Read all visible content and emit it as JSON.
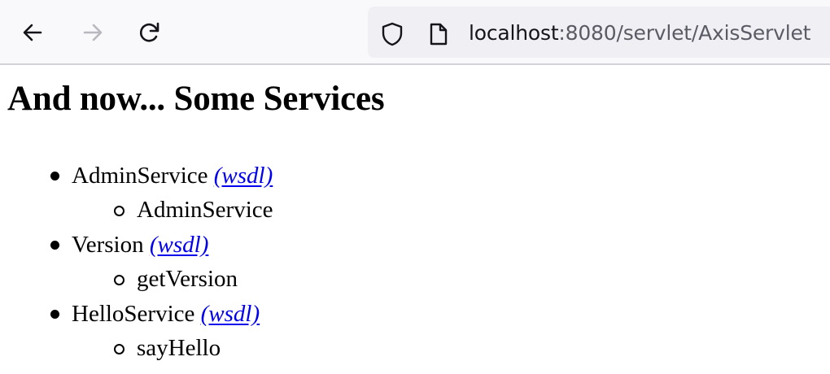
{
  "browser": {
    "back_icon": "arrow-left-icon",
    "forward_icon": "arrow-right-icon",
    "reload_icon": "reload-icon",
    "shield_icon": "shield-icon",
    "page_icon": "page-icon",
    "url_host": "localhost",
    "url_rest": ":8080/servlet/AxisServlet"
  },
  "page": {
    "title": "And now... Some Services",
    "services": [
      {
        "name": "AdminService",
        "wsdl_label": "(wsdl)",
        "operations": [
          "AdminService"
        ]
      },
      {
        "name": "Version",
        "wsdl_label": "(wsdl)",
        "operations": [
          "getVersion"
        ]
      },
      {
        "name": "HelloService",
        "wsdl_label": "(wsdl)",
        "operations": [
          "sayHello"
        ]
      }
    ]
  },
  "colors": {
    "link": "#0000ee",
    "toolbar_bg": "#f9f9fb",
    "urlbar_bg": "#f0f0f4"
  }
}
